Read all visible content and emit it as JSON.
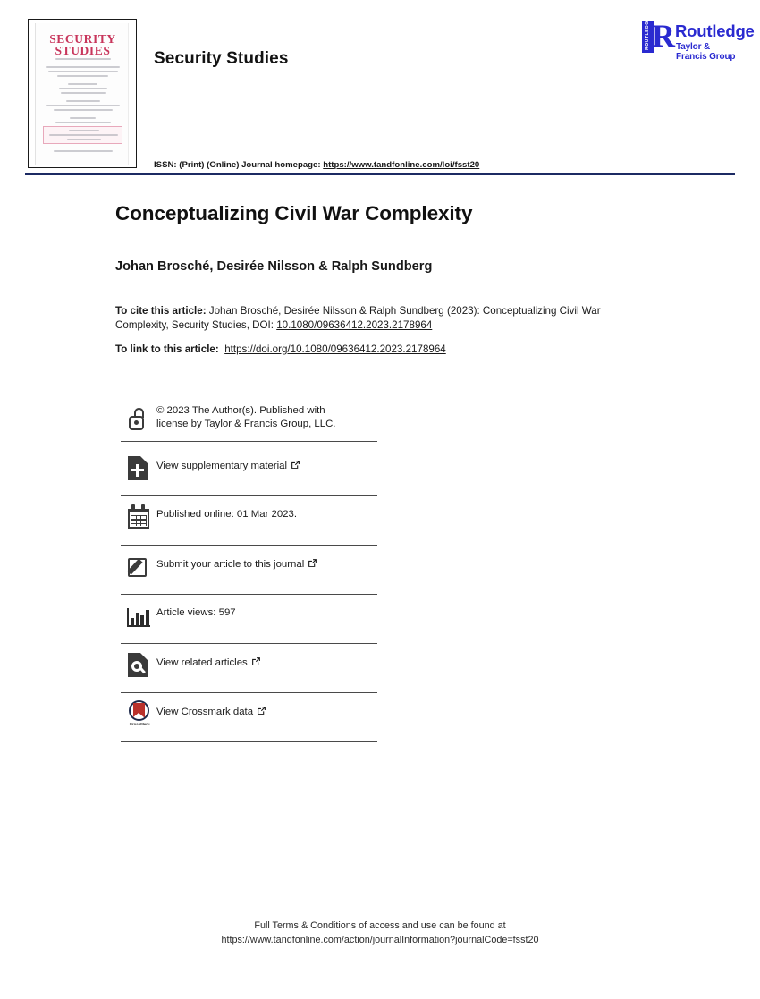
{
  "header": {
    "journal_name": "Security Studies",
    "issn_prefix": "ISSN: (Print) (Online) Journal homepage: ",
    "issn_url": "https://www.tandfonline.com/loi/fsst20",
    "cover": {
      "title_line1": "SECURITY",
      "title_line2": "STUDIES"
    },
    "publisher": {
      "spine_text": "ROUTLEDGE",
      "mark": "R",
      "name": "Routledge",
      "tagline": "Taylor & Francis Group",
      "color": "#2a2ad0"
    },
    "rule_color": "#1c2a63"
  },
  "article": {
    "title": "Conceptualizing Civil War Complexity",
    "authors": "Johan Brosché, Desirée Nilsson & Ralph Sundberg",
    "cite_label": "To cite this article:",
    "cite_text": " Johan Brosché, Desirée Nilsson & Ralph Sundberg (2023): Conceptualizing Civil War Complexity, Security Studies, DOI: ",
    "cite_doi": "10.1080/09636412.2023.2178964",
    "link_label": "To link to this article:",
    "link_url": "https://doi.org/10.1080/09636412.2023.2178964"
  },
  "info_rows": [
    {
      "icon": "open-access-lock-icon",
      "name": "copyright",
      "text_line1": "© 2023 The Author(s). Published with",
      "text_line2": "license by Taylor & Francis Group, LLC.",
      "external": false
    },
    {
      "icon": "document-plus-icon",
      "name": "supplementary-material",
      "text": "View supplementary material",
      "external": true
    },
    {
      "icon": "calendar-icon",
      "name": "published-online",
      "text": "Published online: 01 Mar 2023.",
      "external": false
    },
    {
      "icon": "pencil-square-icon",
      "name": "submit-article",
      "text": "Submit your article to this journal",
      "external": true
    },
    {
      "icon": "bar-chart-icon",
      "name": "article-views",
      "text": "Article views: 597",
      "external": false
    },
    {
      "icon": "document-search-icon",
      "name": "related-articles",
      "text": "View related articles",
      "external": true
    },
    {
      "icon": "crossmark-icon",
      "name": "crossmark-data",
      "text": "View Crossmark data",
      "external": true,
      "icon_caption": "CrossMark"
    }
  ],
  "external_link_glyph": "↗",
  "footer": {
    "line1": "Full Terms & Conditions of access and use can be found at",
    "line2": "https://www.tandfonline.com/action/journalInformation?journalCode=fsst20"
  }
}
